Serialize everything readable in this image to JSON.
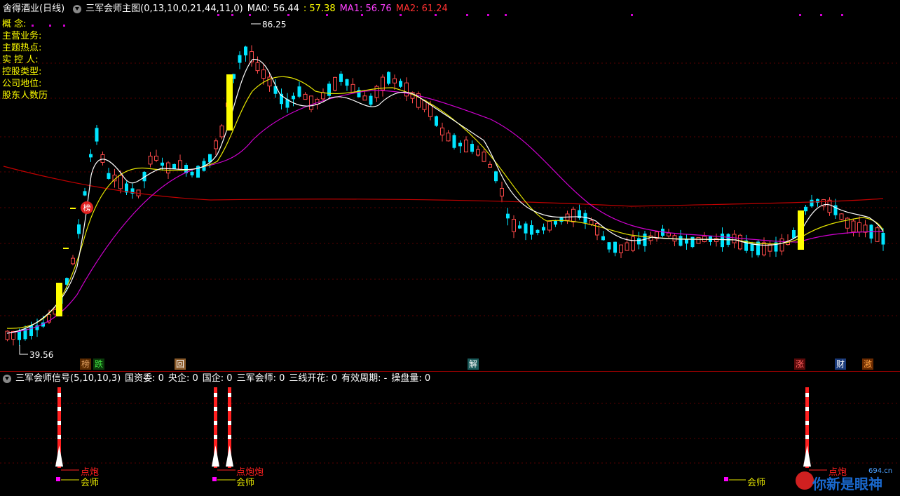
{
  "main_header": {
    "stock": "舍得酒业(日线)",
    "indicator": "三军会师主图(0,13,10,0,21,44,11,0)",
    "ma0": "MA0: 56.44",
    "ma0b": ": 57.38",
    "ma1": "MA1: 56.76",
    "ma2": "MA2: 61.24"
  },
  "info_lines": [
    "概    念:",
    "主营业务:",
    "主题热点:",
    "实 控 人:",
    "控股类型:",
    "公司地位:",
    "股东人数历"
  ],
  "price_labels": {
    "high": "86.25",
    "low": "39.56"
  },
  "markers": {
    "bang": "榜"
  },
  "event_tags": [
    {
      "label": "榜",
      "color": "#e0a060",
      "bg": "#5a2a00"
    },
    {
      "label": "跌",
      "color": "#40e040",
      "bg": "#0a3a0a"
    },
    {
      "label": "回",
      "color": "#ffffff",
      "bg": "#8a5a2a"
    },
    {
      "label": "解",
      "color": "#ffffff",
      "bg": "#1a5a5a"
    },
    {
      "label": "涨",
      "color": "#ff6060",
      "bg": "#5a0a0a"
    },
    {
      "label": "财",
      "color": "#ffffff",
      "bg": "#1a3a7a"
    },
    {
      "label": "激",
      "color": "#ffa040",
      "bg": "#6a2a00"
    }
  ],
  "sub_header": {
    "name": "三军会师信号(5,10,10,3)",
    "items": [
      "国资委: 0",
      "央企: 0",
      "国企: 0",
      "三军会师: 0",
      "三线开花: 0",
      "有效周期: -",
      "操盘量: 0"
    ]
  },
  "signal_labels": {
    "dianpao": "点炮",
    "huishi": "会师",
    "dianpao2": "点炮炮"
  },
  "watermark": {
    "site": "694.cn",
    "text": "你新是眼神"
  },
  "colors": {
    "up": "#ff4a4a",
    "down": "#00e5ff",
    "ma_white": "#ffffff",
    "ma_yellow": "#e5e500",
    "ma_magenta": "#d000d0",
    "ma_red": "#c00000"
  }
}
